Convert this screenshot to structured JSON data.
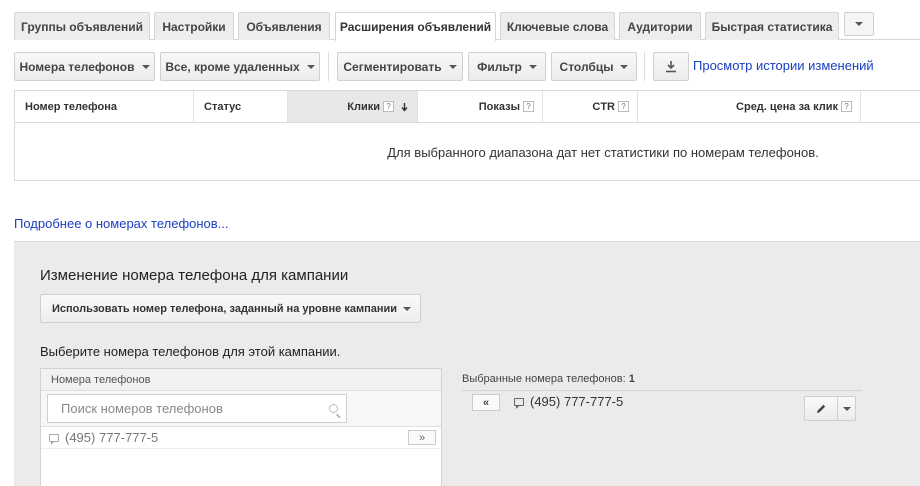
{
  "tabs": [
    {
      "label": "Группы объявлений"
    },
    {
      "label": "Настройки"
    },
    {
      "label": "Объявления"
    },
    {
      "label": "Расширения объявлений",
      "active": true
    },
    {
      "label": "Ключевые слова"
    },
    {
      "label": "Аудитории"
    },
    {
      "label": "Быстрая статистика"
    }
  ],
  "toolbar": {
    "extension_type": "Номера телефонов",
    "status_filter": "Все, кроме удаленных",
    "segment": "Сегментировать",
    "filter": "Фильтр",
    "columns": "Столбцы",
    "download_icon": "download-icon",
    "history_link": "Просмотр истории изменений"
  },
  "table": {
    "columns": [
      {
        "label": "Номер телефона",
        "help": false
      },
      {
        "label": "Статус",
        "help": false
      },
      {
        "label": "Клики",
        "help": true,
        "sorted": "desc"
      },
      {
        "label": "Показы",
        "help": true
      },
      {
        "label": "CTR",
        "help": true
      },
      {
        "label": "Сред. цена за клик",
        "help": true
      }
    ],
    "help_glyph": "?",
    "empty_message": "Для выбранного диапазона дат нет статистики по номерам телефонов."
  },
  "learn_more_link": "Подробнее о номерах телефонов...",
  "panel": {
    "title": "Изменение номера телефона для кампании",
    "mode_dropdown": "Использовать номер телефона, заданный на уровне кампании",
    "choose_label": "Выберите номера телефонов для этой кампании.",
    "available": {
      "header": "Номера телефонов",
      "search_placeholder": "Поиск номеров телефонов",
      "items": [
        {
          "number": "(495) 777-777-5",
          "add_glyph": "»"
        }
      ]
    },
    "selected": {
      "header_prefix": "Выбранные номера телефонов: ",
      "count": "1",
      "remove_glyph": "«",
      "items": [
        {
          "number": "(495) 777-777-5"
        }
      ]
    }
  },
  "colors": {
    "link": "#1a3fbf",
    "panel_bg": "#ebebeb",
    "tab_bg": "#ededed"
  }
}
